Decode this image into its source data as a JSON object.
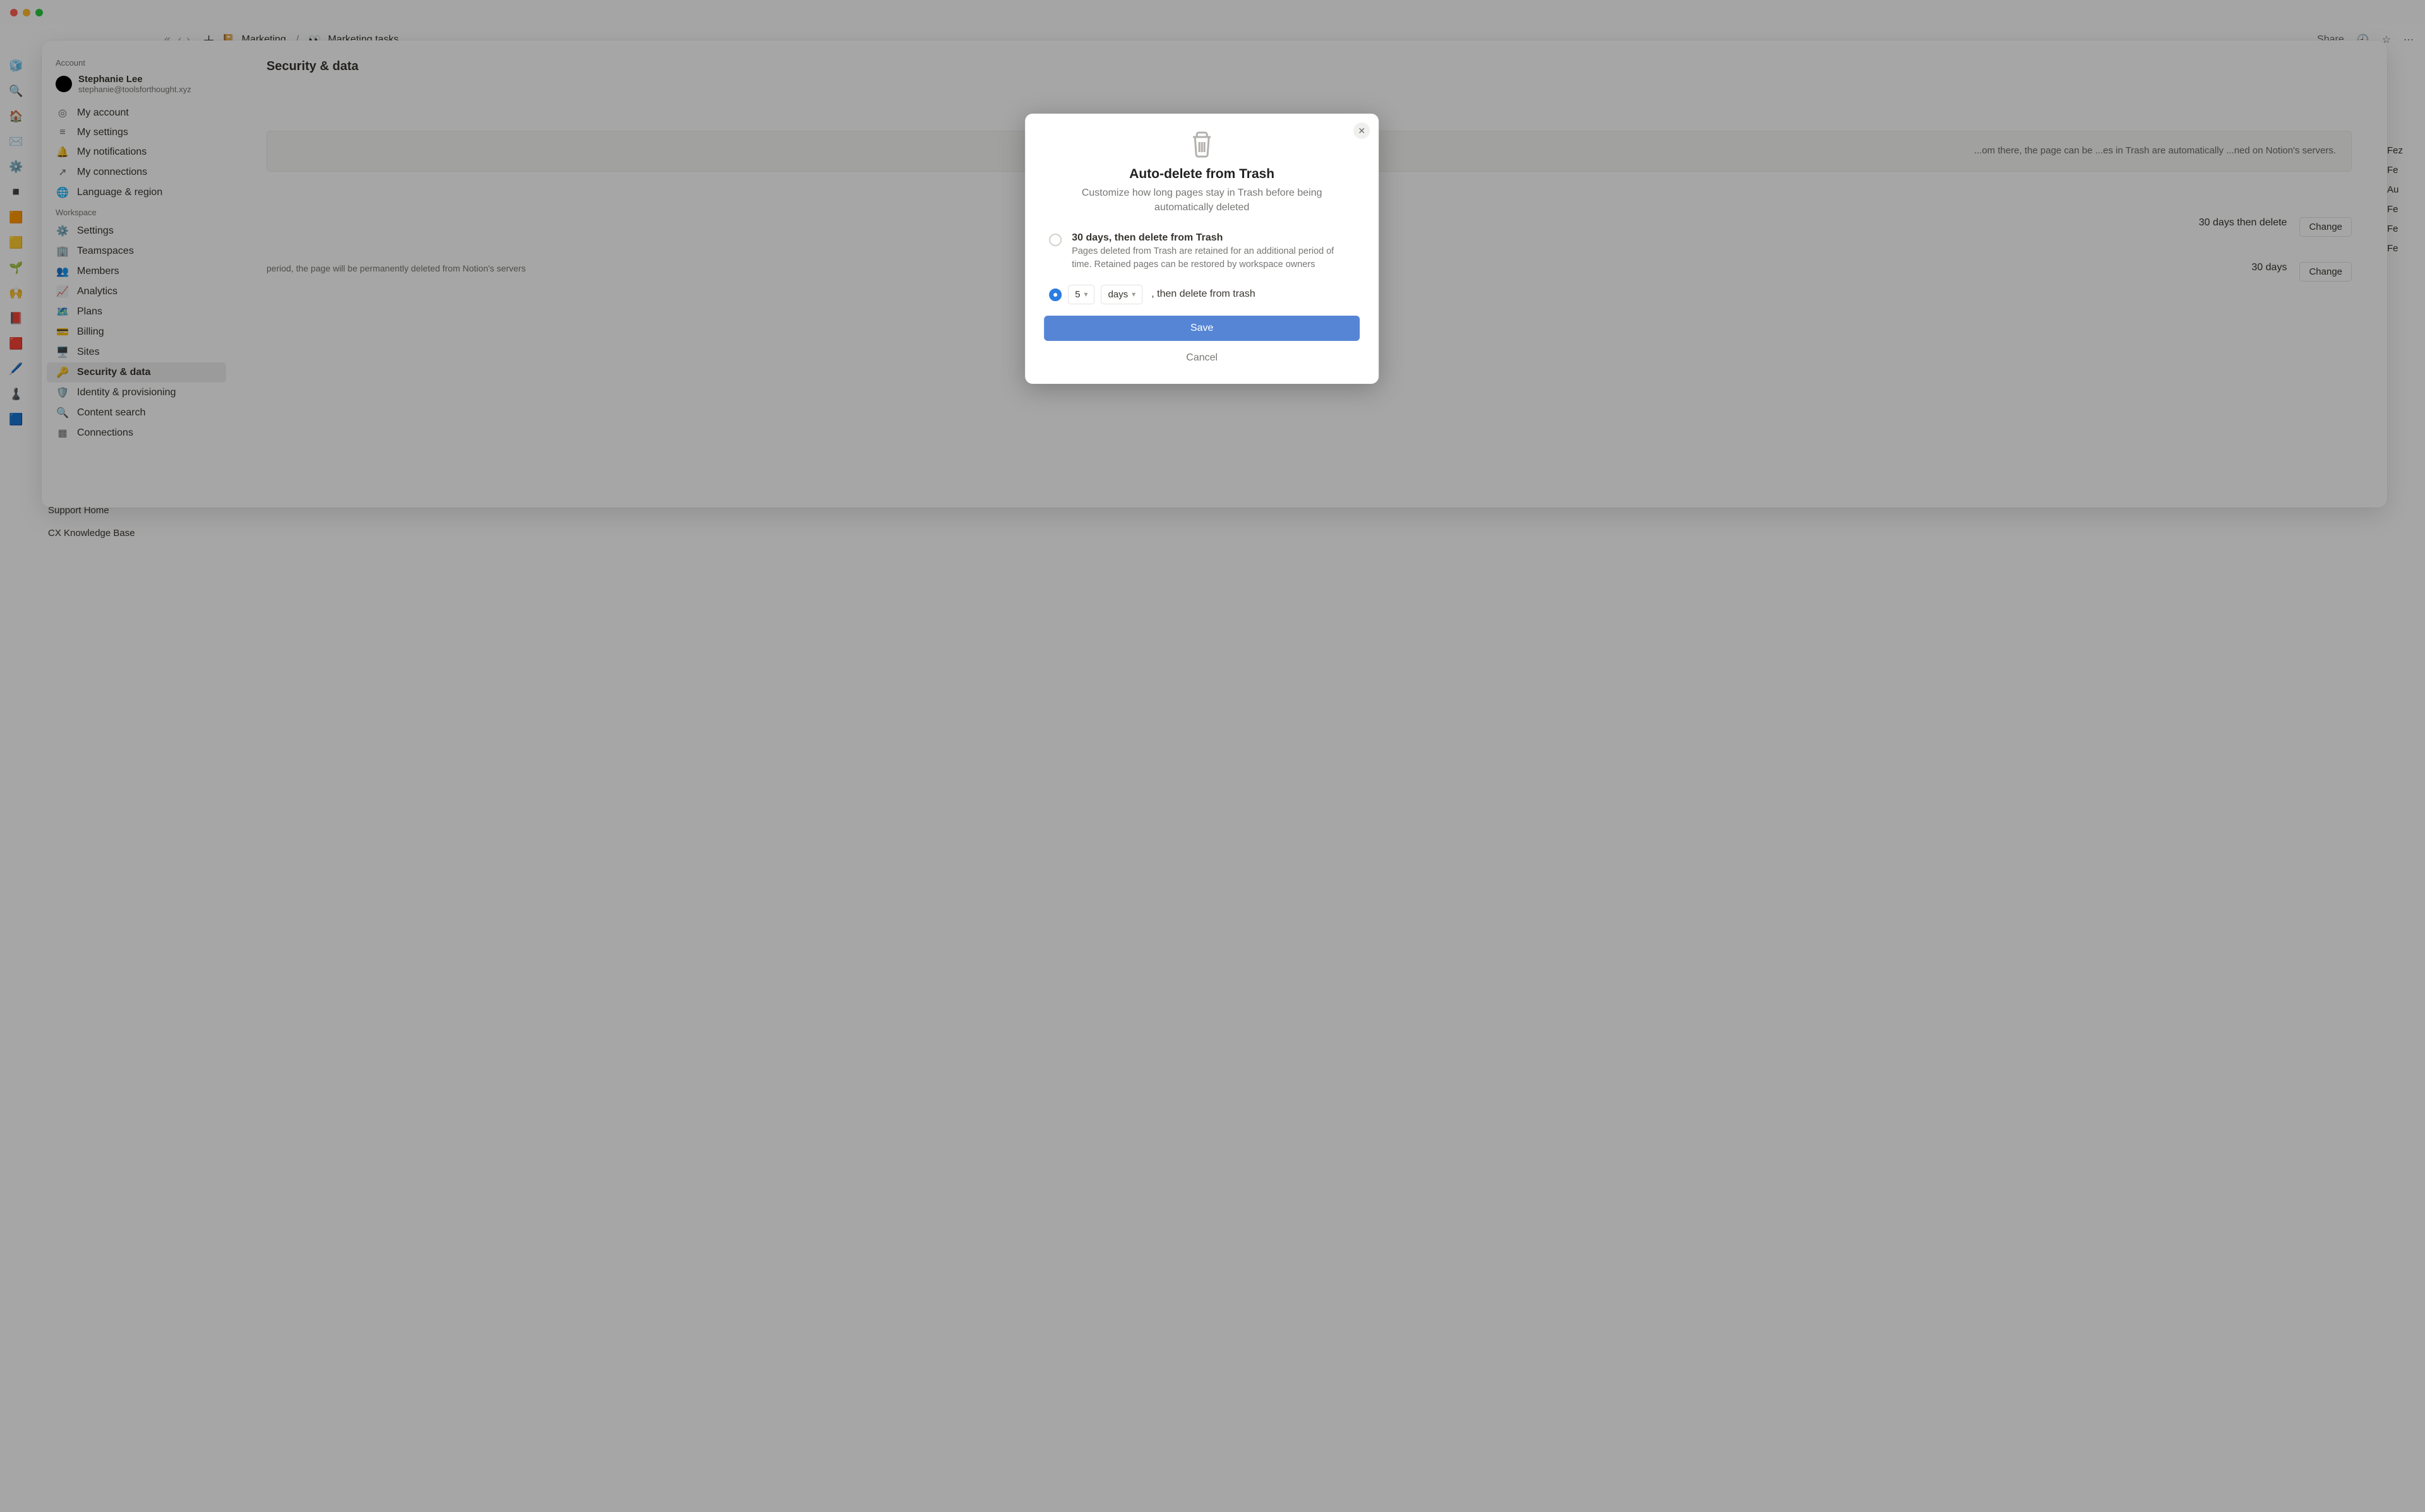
{
  "topbar": {
    "breadcrumbs": {
      "parent_icon": "📔",
      "parent": "Marketing",
      "current_icon": "👀",
      "current": "Marketing tasks"
    },
    "share_label": "Share"
  },
  "rail_items": [
    "🧊",
    "🔍",
    "🏠",
    "✉️",
    "⚙️",
    "◾",
    "🟧",
    "🟨",
    "🌱",
    "🙌",
    "📕",
    "🟥",
    "🖊️",
    "♟️",
    "🟦"
  ],
  "rail_bottom_1": "Support Home",
  "rail_bottom_2": "CX Knowledge Base",
  "bg_right_labels": [
    "Fez",
    "Fe",
    "Au",
    "Fe",
    "Fe",
    "Fe"
  ],
  "settings": {
    "section_account": "Account",
    "profile": {
      "name": "Stephanie Lee",
      "email": "stephanie@toolsforthought.xyz"
    },
    "account_items": [
      "My account",
      "My settings",
      "My notifications",
      "My connections",
      "Language & region"
    ],
    "section_workspace": "Workspace",
    "workspace_items": [
      "Settings",
      "Teamspaces",
      "Members",
      "Analytics",
      "Plans",
      "Billing",
      "Sites",
      "Security & data",
      "Identity & provisioning",
      "Content search",
      "Connections"
    ],
    "active_index": 7,
    "content": {
      "title": "Security & data",
      "info_box": "...om there, the page can be ...es in Trash are automatically ...ned on Notion's servers.",
      "row1": {
        "value": "30 days then delete",
        "change": "Change"
      },
      "row2": {
        "value": "30 days",
        "change": "Change",
        "desc": "period, the page will be permanently deleted from Notion's servers"
      }
    }
  },
  "modal": {
    "title": "Auto-delete from Trash",
    "subtitle": "Customize how long pages stay in Trash before being automatically deleted",
    "option1_title": "30 days, then delete from Trash",
    "option1_desc": "Pages deleted from Trash are retained for an additional period of time. Retained pages can be restored by workspace owners",
    "custom": {
      "number": "5",
      "unit": "days",
      "suffix": ", then delete from trash"
    },
    "save": "Save",
    "cancel": "Cancel"
  }
}
